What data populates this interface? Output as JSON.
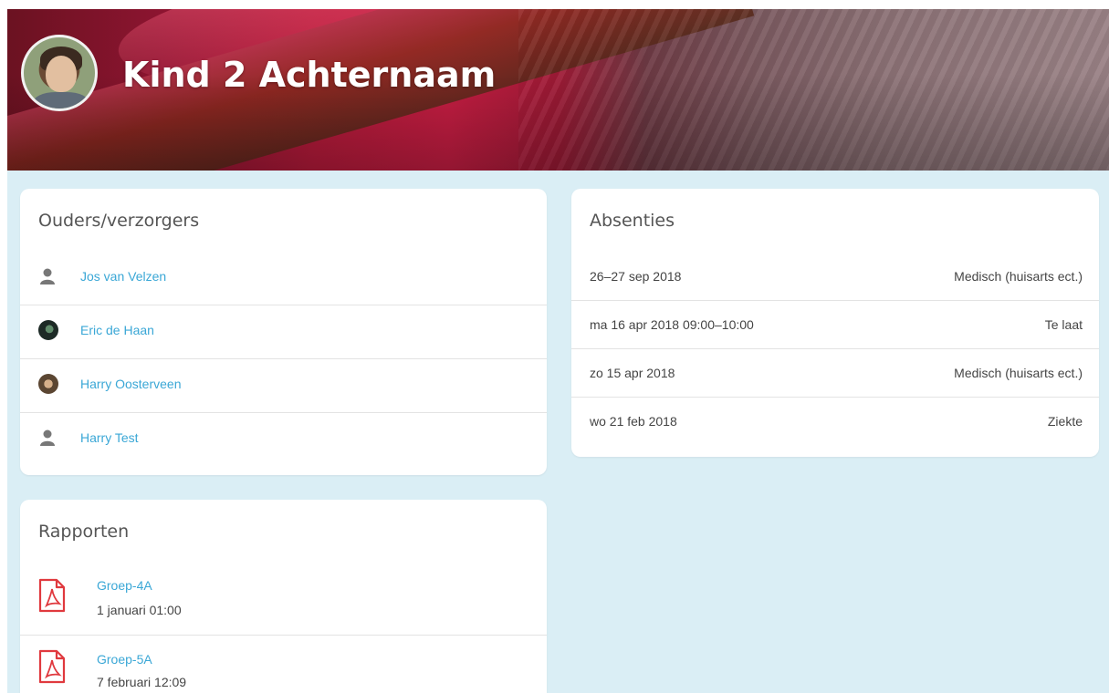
{
  "header": {
    "title": "Kind 2 Achternaam"
  },
  "parents": {
    "title": "Ouders/verzorgers",
    "items": [
      {
        "name": "Jos van Velzen",
        "avatar": "person-icon"
      },
      {
        "name": "Eric de Haan",
        "avatar": "photo-dark"
      },
      {
        "name": "Harry Oosterveen",
        "avatar": "photo-face"
      },
      {
        "name": "Harry Test",
        "avatar": "person-icon"
      }
    ]
  },
  "absences": {
    "title": "Absenties",
    "items": [
      {
        "date": "26–27 sep 2018",
        "reason": "Medisch (huisarts ect.)"
      },
      {
        "date": "ma 16 apr 2018 09:00–10:00",
        "reason": "Te laat"
      },
      {
        "date": "zo 15 apr 2018",
        "reason": "Medisch (huisarts ect.)"
      },
      {
        "date": "wo 21 feb 2018",
        "reason": "Ziekte"
      }
    ]
  },
  "reports": {
    "title": "Rapporten",
    "items": [
      {
        "name": "Groep-4A",
        "date": "1 januari 01:00",
        "icon": "pdf-icon"
      },
      {
        "name": "Groep-5A",
        "date": "7 februari 12:09",
        "icon": "pdf-icon"
      }
    ]
  },
  "colors": {
    "link": "#3aa7d6",
    "background": "#daeef5",
    "pdf_red": "#e0393e"
  }
}
